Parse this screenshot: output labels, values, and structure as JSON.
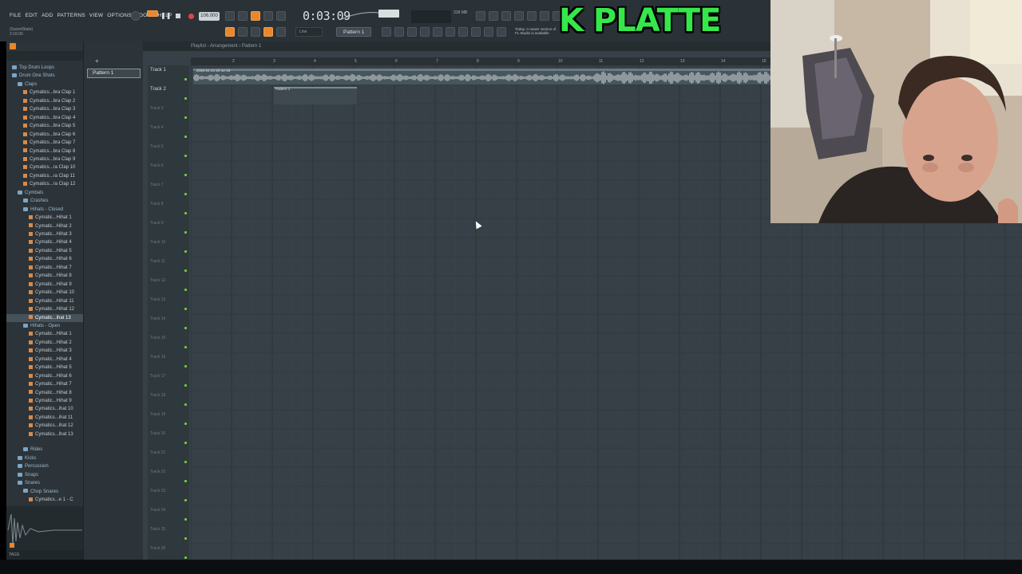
{
  "menu": [
    "FILE",
    "EDIT",
    "ADD",
    "PATTERNS",
    "VIEW",
    "OPTIONS",
    "TOOLS",
    "HELP"
  ],
  "hint": {
    "line1": "(SavedState)",
    "line2": "2:16:00"
  },
  "transport": {
    "tempo": "106.000",
    "time": "0:03:09",
    "memory": "318 MB"
  },
  "toolbar": {
    "pattern_label": "Pattern 1",
    "snap_label": "Line"
  },
  "news": {
    "line1": "Today: A newer version of",
    "line2": "FL Studio is available"
  },
  "overlay": {
    "title": "K PLATTE"
  },
  "browser": {
    "items": [
      {
        "label": "Top Drum Loops",
        "kind": "folder",
        "indent": 1
      },
      {
        "label": "Drum One Shots",
        "kind": "folder",
        "indent": 1
      },
      {
        "label": "Claps",
        "kind": "folder",
        "indent": 2
      },
      {
        "label": "Cymatics...bra Clap 1",
        "kind": "file",
        "indent": 3
      },
      {
        "label": "Cymatics...bra Clap 2",
        "kind": "file",
        "indent": 3
      },
      {
        "label": "Cymatics...bra Clap 3",
        "kind": "file",
        "indent": 3
      },
      {
        "label": "Cymatics...bra Clap 4",
        "kind": "file",
        "indent": 3
      },
      {
        "label": "Cymatics...bra Clap 5",
        "kind": "file",
        "indent": 3
      },
      {
        "label": "Cymatics...bra Clap 6",
        "kind": "file",
        "indent": 3
      },
      {
        "label": "Cymatics...bra Clap 7",
        "kind": "file",
        "indent": 3
      },
      {
        "label": "Cymatics...bra Clap 8",
        "kind": "file",
        "indent": 3
      },
      {
        "label": "Cymatics...bra Clap 9",
        "kind": "file",
        "indent": 3
      },
      {
        "label": "Cymatics...ra Clap 10",
        "kind": "file",
        "indent": 3
      },
      {
        "label": "Cymatics...ra Clap 11",
        "kind": "file",
        "indent": 3
      },
      {
        "label": "Cymatics...ra Clap 12",
        "kind": "file",
        "indent": 3
      },
      {
        "label": "Cymbals",
        "kind": "folder",
        "indent": 2
      },
      {
        "label": "Crashes",
        "kind": "folder",
        "indent": 3
      },
      {
        "label": "Hihats - Closed",
        "kind": "folder",
        "indent": 3
      },
      {
        "label": "Cymatic...Hihat 1",
        "kind": "file",
        "indent": 4
      },
      {
        "label": "Cymatic...Hihat 2",
        "kind": "file",
        "indent": 4
      },
      {
        "label": "Cymatic...Hihat 3",
        "kind": "file",
        "indent": 4
      },
      {
        "label": "Cymatic...Hihat 4",
        "kind": "file",
        "indent": 4
      },
      {
        "label": "Cymatic...Hihat 5",
        "kind": "file",
        "indent": 4
      },
      {
        "label": "Cymatic...Hihat 6",
        "kind": "file",
        "indent": 4
      },
      {
        "label": "Cymatic...Hihat 7",
        "kind": "file",
        "indent": 4
      },
      {
        "label": "Cymatic...Hihat 8",
        "kind": "file",
        "indent": 4
      },
      {
        "label": "Cymatic...Hihat 9",
        "kind": "file",
        "indent": 4
      },
      {
        "label": "Cymatic...Hihat 10",
        "kind": "file",
        "indent": 4
      },
      {
        "label": "Cymatic...Hihat 11",
        "kind": "file",
        "indent": 4
      },
      {
        "label": "Cymatic...Hihat 12",
        "kind": "file",
        "indent": 4
      },
      {
        "label": "Cymatic...ihat 13",
        "kind": "file",
        "indent": 4,
        "selected": true
      },
      {
        "label": "Hihats - Open",
        "kind": "folder",
        "indent": 3
      },
      {
        "label": "Cymatic...Hihat 1",
        "kind": "file",
        "indent": 4
      },
      {
        "label": "Cymatic...Hihat 2",
        "kind": "file",
        "indent": 4
      },
      {
        "label": "Cymatic...Hihat 3",
        "kind": "file",
        "indent": 4
      },
      {
        "label": "Cymatic...Hihat 4",
        "kind": "file",
        "indent": 4
      },
      {
        "label": "Cymatic...Hihat 5",
        "kind": "file",
        "indent": 4
      },
      {
        "label": "Cymatic...Hihat 6",
        "kind": "file",
        "indent": 4
      },
      {
        "label": "Cymatic...Hihat 7",
        "kind": "file",
        "indent": 4
      },
      {
        "label": "Cymatic...Hihat 8",
        "kind": "file",
        "indent": 4
      },
      {
        "label": "Cymatic...Hihat 9",
        "kind": "file",
        "indent": 4
      },
      {
        "label": "Cymatics...ihat 10",
        "kind": "file",
        "indent": 4
      },
      {
        "label": "Cymatics...ihat 11",
        "kind": "file",
        "indent": 4
      },
      {
        "label": "Cymatics...ihat 12",
        "kind": "file",
        "indent": 4
      },
      {
        "label": "Cymatics...ihat 13",
        "kind": "file",
        "indent": 4
      },
      {
        "label": "",
        "kind": "spacer",
        "indent": 0
      },
      {
        "label": "Rides",
        "kind": "folder",
        "indent": 3
      },
      {
        "label": "Kicks",
        "kind": "folder",
        "indent": 2
      },
      {
        "label": "Percussion",
        "kind": "folder",
        "indent": 2
      },
      {
        "label": "Snaps",
        "kind": "folder",
        "indent": 2
      },
      {
        "label": "Snares",
        "kind": "folder",
        "indent": 2
      },
      {
        "label": "Chop Snares",
        "kind": "folder",
        "indent": 3
      },
      {
        "label": "Cymatics...e 1 - C",
        "kind": "file",
        "indent": 4
      }
    ],
    "footer": "TAGS"
  },
  "picker": {
    "hint": "+",
    "selected_pattern": "Pattern 1"
  },
  "playlist": {
    "title": "Playlist - Arrangement › Pattern 1",
    "bars": [
      "2",
      "3",
      "4",
      "5",
      "6",
      "7",
      "8",
      "9",
      "10",
      "11",
      "12",
      "13",
      "14",
      "15"
    ],
    "tracks": [
      "Track 1",
      "Track 2",
      "Track 3",
      "Track 4",
      "Track 5",
      "Track 6",
      "Track 7",
      "Track 8",
      "Track 9",
      "Track 10",
      "Track 11",
      "Track 12",
      "Track 13",
      "Track 14",
      "Track 15",
      "Track 16",
      "Track 17",
      "Track 18",
      "Track 19",
      "Track 20",
      "Track 21",
      "Track 22",
      "Track 23",
      "Track 24",
      "Track 25",
      "Track 26"
    ],
    "audio_clip_label": "2026-04-23 20-42-18",
    "pattern_clip_label": "Pattern 1"
  }
}
